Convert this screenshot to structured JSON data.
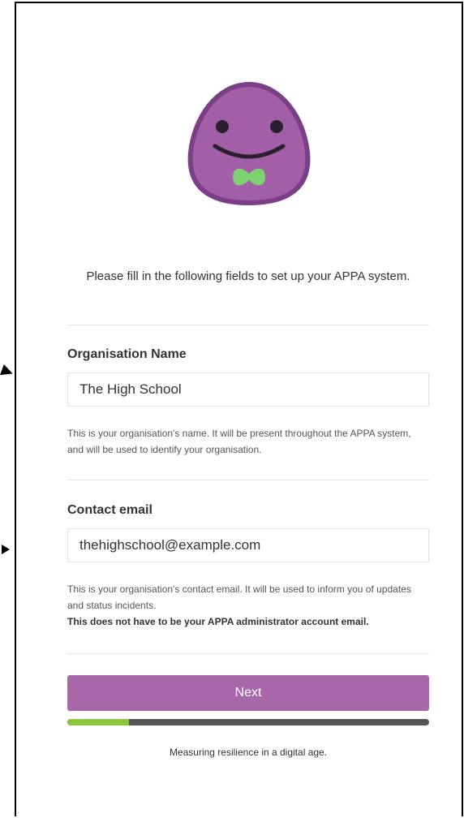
{
  "intro_text": "Please fill in the following fields to set up your APPA system.",
  "organisation": {
    "label": "Organisation Name",
    "value": "The High School",
    "help": "This is your organisation's name. It will be present throughout the APPA system, and will be used to identify your organisation."
  },
  "contact": {
    "label": "Contact email",
    "value": "thehighschool@example.com",
    "help": "This is your organisation's contact email. It will be used to inform you of updates and status incidents.",
    "help_bold": "This does not have to be your APPA administrator account email."
  },
  "next_label": "Next",
  "progress": 0.17,
  "tagline": "Measuring resilience in a digital age.",
  "colors": {
    "brand": "#a867a9",
    "mascot_body": "#a25ea6",
    "mascot_outline": "#7b3f88",
    "bowtie": "#7ed070",
    "progress_fill": "#8cc63f",
    "progress_track": "#555555"
  },
  "icons": {
    "mascot": "purple-blob-mascot-with-bowtie"
  }
}
